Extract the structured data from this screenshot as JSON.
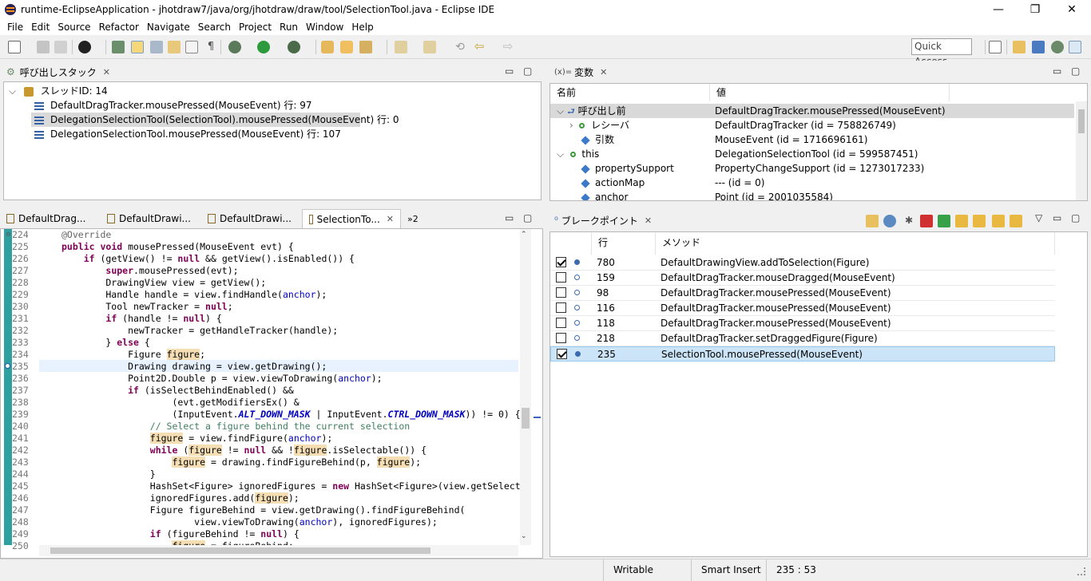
{
  "window": {
    "title": "runtime-EclipseApplication - jhotdraw7/java/org/jhotdraw/draw/tool/SelectionTool.java - Eclipse IDE",
    "minimize": "—",
    "restore": "❐",
    "close": "✕"
  },
  "menu": [
    "File",
    "Edit",
    "Source",
    "Refactor",
    "Navigate",
    "Search",
    "Project",
    "Run",
    "Window",
    "Help"
  ],
  "toolbar": {
    "quick_access": "Quick Access"
  },
  "callstack": {
    "tab_label": "呼び出しスタック",
    "thread": "スレッドID: 14",
    "frames": [
      "DefaultDragTracker.mousePressed(MouseEvent) 行: 97",
      "DelegationSelectionTool(SelectionTool).mousePressed(MouseEvent) 行: 0",
      "DelegationSelectionTool.mousePressed(MouseEvent) 行: 107"
    ]
  },
  "variables": {
    "tab_label": "変数",
    "tab_prefix": "(x)=",
    "col_name": "名前",
    "col_value": "値",
    "rows": [
      {
        "name": "呼び出し前",
        "value": "DefaultDragTracker.mousePressed(MouseEvent)"
      },
      {
        "name": "レシーバ",
        "value": "DefaultDragTracker (id = 758826749)"
      },
      {
        "name": "引数",
        "value": "MouseEvent (id = 1716696161)"
      },
      {
        "name": "this",
        "value": "DelegationSelectionTool (id = 599587451)"
      },
      {
        "name": "propertySupport",
        "value": "PropertyChangeSupport (id = 1273017233)"
      },
      {
        "name": "actionMap",
        "value": "--- (id = 0)"
      },
      {
        "name": "anchor",
        "value": "Point (id = 2001035584)"
      }
    ]
  },
  "editor": {
    "tabs": [
      "DefaultDrag...",
      "DefaultDrawi...",
      "DefaultDrawi...",
      "SelectionTo..."
    ],
    "overflow": "»2",
    "line_numbers": [
      "224",
      "225",
      "226",
      "227",
      "228",
      "229",
      "230",
      "231",
      "232",
      "233",
      "234",
      "235",
      "236",
      "237",
      "238",
      "239",
      "240",
      "241",
      "242",
      "243",
      "244",
      "245",
      "246",
      "247",
      "248",
      "249",
      "250"
    ]
  },
  "breakpoints": {
    "tab_label": "ブレークポイント",
    "col_line": "行",
    "col_method": "メソッド",
    "rows": [
      {
        "checked": true,
        "line": "780",
        "method": "DefaultDrawingView.addToSelection(Figure)"
      },
      {
        "checked": false,
        "line": "159",
        "method": "DefaultDragTracker.mouseDragged(MouseEvent)"
      },
      {
        "checked": false,
        "line": "98",
        "method": "DefaultDragTracker.mousePressed(MouseEvent)"
      },
      {
        "checked": false,
        "line": "116",
        "method": "DefaultDragTracker.mousePressed(MouseEvent)"
      },
      {
        "checked": false,
        "line": "118",
        "method": "DefaultDragTracker.mousePressed(MouseEvent)"
      },
      {
        "checked": false,
        "line": "218",
        "method": "DefaultDragTracker.setDraggedFigure(Figure)"
      },
      {
        "checked": true,
        "line": "235",
        "method": "SelectionTool.mousePressed(MouseEvent)"
      }
    ]
  },
  "status": {
    "writable": "Writable",
    "insert": "Smart Insert",
    "position": "235 : 53"
  }
}
